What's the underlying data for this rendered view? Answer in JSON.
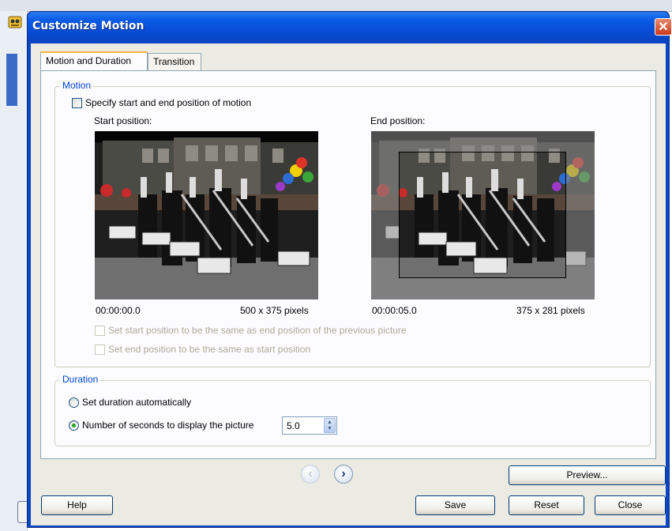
{
  "dialog": {
    "title": "Customize Motion",
    "close_glyph": "✕"
  },
  "tabs": [
    {
      "label": "Motion and Duration",
      "active": true
    },
    {
      "label": "Transition",
      "active": false
    }
  ],
  "motion": {
    "group_title": "Motion",
    "specify_label": "Specify start and end position of motion",
    "specify_checked": false,
    "start": {
      "label": "Start position:",
      "time": "00:00:00.0",
      "size": "500 x 375 pixels"
    },
    "end": {
      "label": "End position:",
      "time": "00:00:05.0",
      "size": "375 x 281 pixels"
    },
    "same_as_prev_label": "Set start position to be the same as end position of the previous picture",
    "same_as_start_label": "Set end position to be the same as start position"
  },
  "duration": {
    "group_title": "Duration",
    "auto_label": "Set duration automatically",
    "seconds_label": "Number of seconds to display the picture",
    "selected": "seconds",
    "seconds_value": "5.0"
  },
  "nav": {
    "prev_glyph": "‹",
    "next_glyph": "›",
    "prev_enabled": false,
    "next_enabled": true
  },
  "buttons": {
    "preview": "Preview...",
    "help": "Help",
    "save": "Save",
    "reset": "Reset",
    "close": "Close"
  },
  "colors": {
    "title_bar": "#0a5ce6",
    "group_title": "#0046d5",
    "close_button": "#cc3a1a"
  }
}
